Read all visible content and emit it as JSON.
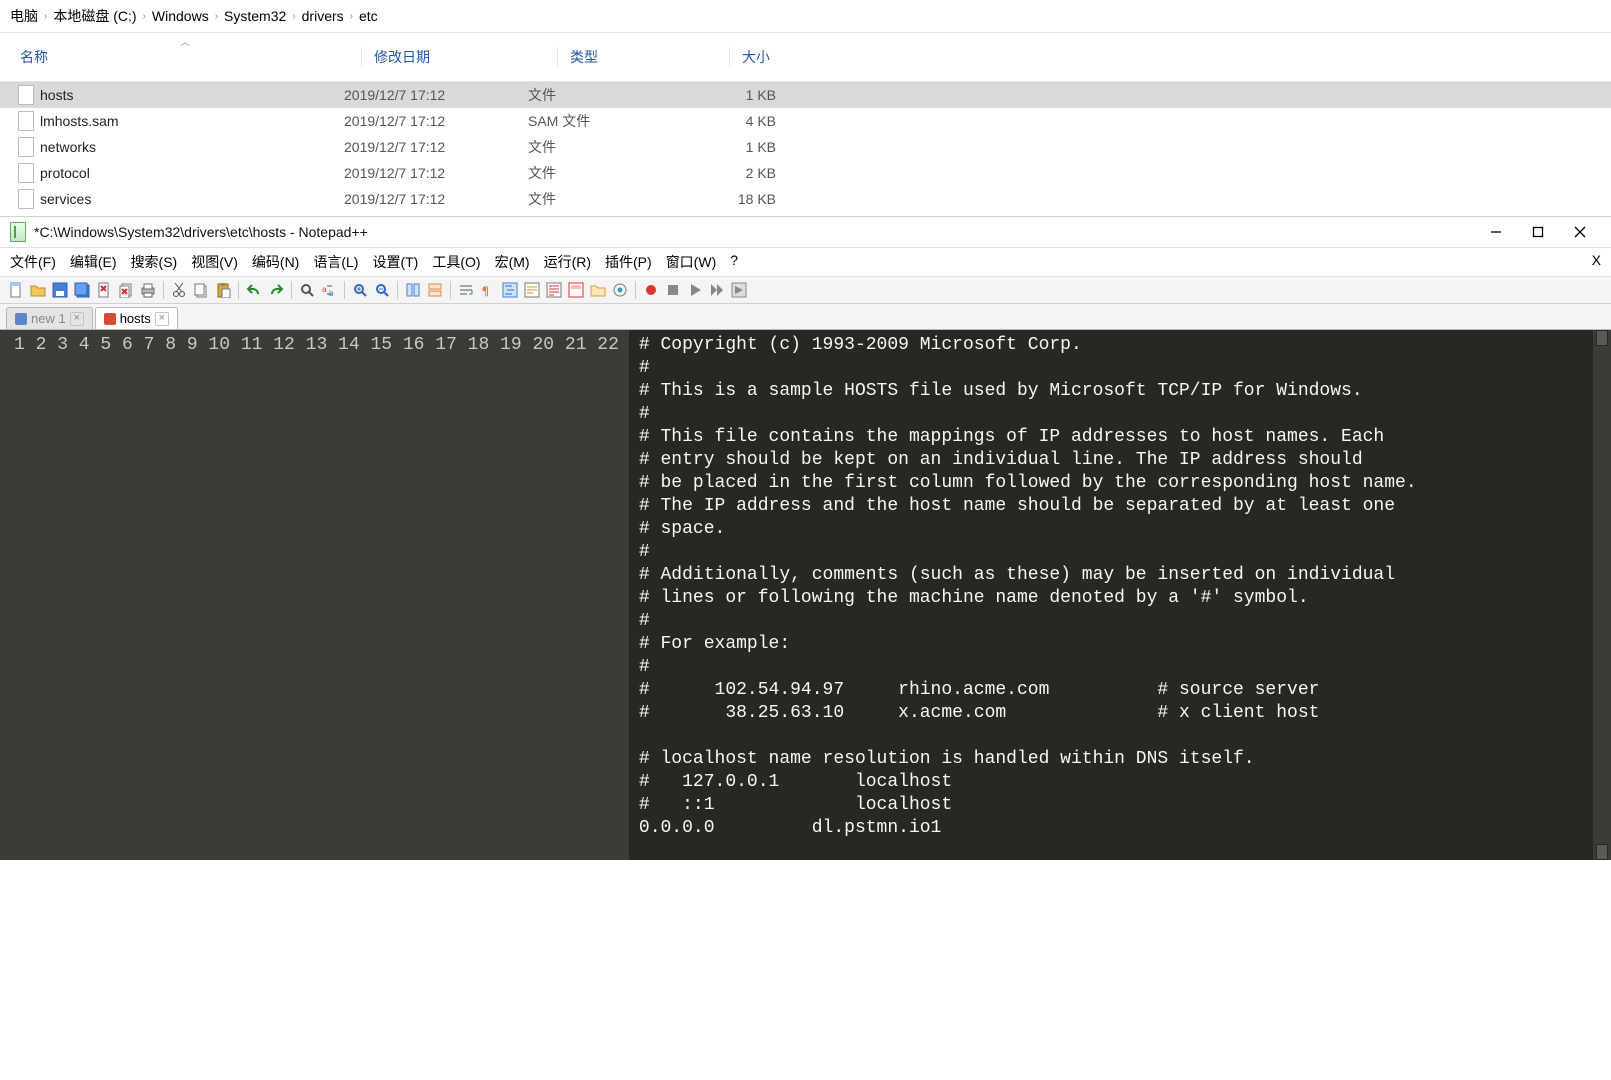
{
  "explorer": {
    "breadcrumb": [
      "电脑",
      "本地磁盘 (C:)",
      "Windows",
      "System32",
      "drivers",
      "etc"
    ],
    "columns": {
      "name": "名称",
      "date": "修改日期",
      "type": "类型",
      "size": "大小"
    },
    "files": [
      {
        "name": "hosts",
        "date": "2019/12/7 17:12",
        "type": "文件",
        "size": "1 KB",
        "selected": true
      },
      {
        "name": "lmhosts.sam",
        "date": "2019/12/7 17:12",
        "type": "SAM 文件",
        "size": "4 KB",
        "selected": false
      },
      {
        "name": "networks",
        "date": "2019/12/7 17:12",
        "type": "文件",
        "size": "1 KB",
        "selected": false
      },
      {
        "name": "protocol",
        "date": "2019/12/7 17:12",
        "type": "文件",
        "size": "2 KB",
        "selected": false
      },
      {
        "name": "services",
        "date": "2019/12/7 17:12",
        "type": "文件",
        "size": "18 KB",
        "selected": false
      }
    ]
  },
  "npp": {
    "title": "*C:\\Windows\\System32\\drivers\\etc\\hosts - Notepad++",
    "menu": [
      "文件(F)",
      "编辑(E)",
      "搜索(S)",
      "视图(V)",
      "编码(N)",
      "语言(L)",
      "设置(T)",
      "工具(O)",
      "宏(M)",
      "运行(R)",
      "插件(P)",
      "窗口(W)",
      "?"
    ],
    "tabs": [
      {
        "label": "new 1",
        "active": false,
        "dot": "blue"
      },
      {
        "label": "hosts",
        "active": true,
        "dot": "red"
      }
    ],
    "toolbar_icons": [
      "new-file-icon",
      "open-folder-icon",
      "save-icon",
      "save-all-icon",
      "close-icon",
      "close-all-icon",
      "print-icon",
      "sep",
      "cut-icon",
      "copy-icon",
      "paste-icon",
      "sep",
      "undo-icon",
      "redo-icon",
      "sep",
      "find-icon",
      "replace-icon",
      "sep",
      "zoom-in-icon",
      "zoom-out-icon",
      "sep",
      "sync-v-icon",
      "sync-h-icon",
      "sep",
      "word-wrap-icon",
      "all-chars-icon",
      "indent-guide-icon",
      "lang-icon",
      "doc-map-icon",
      "doc-list-icon",
      "folder-icon",
      "monitor-icon",
      "sep",
      "record-icon",
      "stop-icon",
      "play-icon",
      "play-multi-icon",
      "save-macro-icon"
    ],
    "lines": [
      "# Copyright (c) 1993-2009 Microsoft Corp.",
      "#",
      "# This is a sample HOSTS file used by Microsoft TCP/IP for Windows.",
      "#",
      "# This file contains the mappings of IP addresses to host names. Each",
      "# entry should be kept on an individual line. The IP address should",
      "# be placed in the first column followed by the corresponding host name.",
      "# The IP address and the host name should be separated by at least one",
      "# space.",
      "#",
      "# Additionally, comments (such as these) may be inserted on individual",
      "# lines or following the machine name denoted by a '#' symbol.",
      "#",
      "# For example:",
      "#",
      "#      102.54.94.97     rhino.acme.com          # source server",
      "#       38.25.63.10     x.acme.com              # x client host",
      "",
      "# localhost name resolution is handled within DNS itself.",
      "#   127.0.0.1       localhost",
      "#   ::1             localhost",
      "0.0.0.0         dl.pstmn.io1"
    ]
  }
}
